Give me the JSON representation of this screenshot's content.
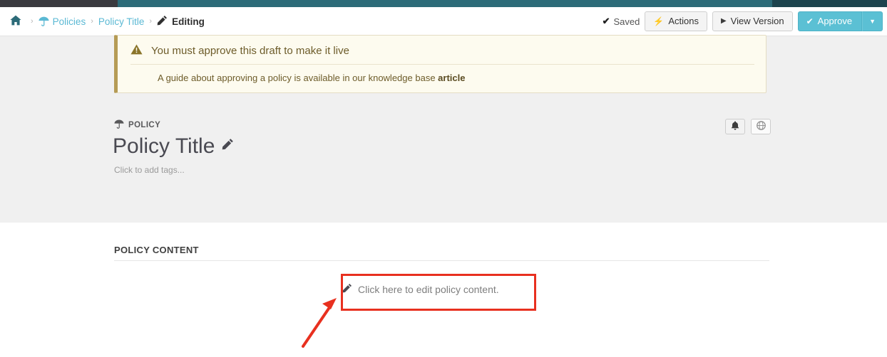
{
  "topbar": {
    "segments": [
      "#3a3a3f",
      "#2c6b78",
      "#1d444e"
    ]
  },
  "breadcrumb": {
    "home_icon": "home-icon",
    "separator": "›",
    "items": [
      {
        "label": "Policies",
        "icon": "umbrella-icon",
        "current": false
      },
      {
        "label": "Policy Title",
        "icon": "",
        "current": false
      },
      {
        "label": "Editing",
        "icon": "pencil-icon",
        "current": true
      }
    ]
  },
  "toolbar": {
    "saved_label": "Saved",
    "saved_icon": "check-icon",
    "actions_label": "Actions",
    "actions_icon": "bolt-icon",
    "view_version_label": "View Version",
    "view_version_icon": "play-icon",
    "approve_label": "Approve",
    "approve_icon": "check-icon",
    "approve_caret_icon": "caret-down-icon"
  },
  "alert": {
    "icon": "warning-triangle-icon",
    "heading": "You must approve this draft to make it live",
    "body_text": "A guide about approving a policy is available in our knowledge base ",
    "body_link": "article"
  },
  "policy": {
    "kicker": "POLICY",
    "kicker_icon": "umbrella-icon",
    "title": "Policy Title",
    "title_edit_icon": "pencil-icon",
    "tags_placeholder": "Click to add tags...",
    "bell_icon": "bell-icon",
    "globe_icon": "globe-icon"
  },
  "content_section": {
    "heading": "POLICY CONTENT",
    "edit_prompt": "Click here to edit policy content.",
    "edit_prompt_icon": "pencil-icon"
  },
  "annotation": {
    "color": "#e8301f",
    "shapes": [
      "highlight-rectangle",
      "pointer-arrow"
    ]
  },
  "colors": {
    "brand_teal": "#2c6b78",
    "link_blue": "#5bb9d4",
    "approve_blue": "#5bc0d4",
    "alert_bg": "#fdfbef",
    "alert_border": "#b59b55",
    "hero_bg": "#f0f0f0",
    "annotation_red": "#e8301f"
  }
}
